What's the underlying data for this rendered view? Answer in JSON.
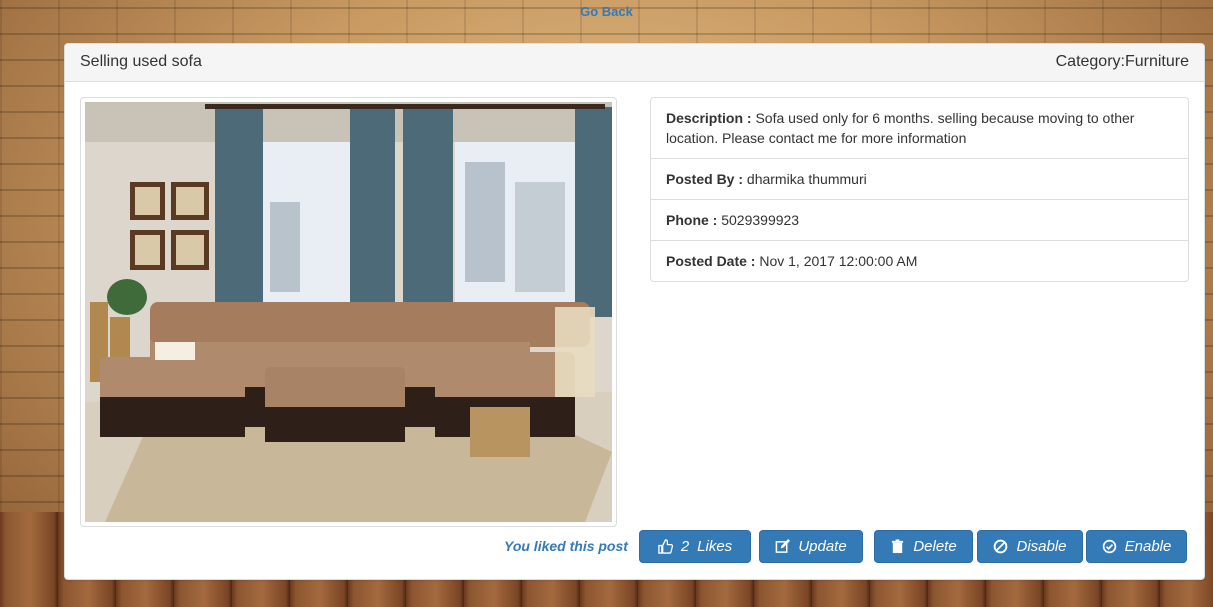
{
  "nav": {
    "go_back": "Go Back"
  },
  "post": {
    "title": "Selling used sofa",
    "category": "Category:Furniture",
    "image_alt": "Sofa photo",
    "description_label": "Description : ",
    "description": "Sofa used only for 6 months. selling because  moving to other location. Please contact me for more information",
    "posted_by_label": "Posted By : ",
    "posted_by": "dharmika thummuri",
    "phone_label": "Phone : ",
    "phone": "5029399923",
    "posted_date_label": "Posted Date : ",
    "posted_date": "Nov 1, 2017 12:00:00 AM"
  },
  "actions": {
    "liked_text": "You liked this post",
    "likes_count": "2",
    "likes_label": "Likes",
    "update_label": "Update",
    "delete_label": "Delete",
    "disable_label": "Disable",
    "enable_label": "Enable"
  },
  "icons": [
    "thumbs-up-icon",
    "edit-icon",
    "trash-icon",
    "ban-icon",
    "check-circle-icon"
  ],
  "colors": {
    "primary": "#337ab7",
    "link": "#337ab7",
    "panel_header": "#f5f5f5"
  }
}
